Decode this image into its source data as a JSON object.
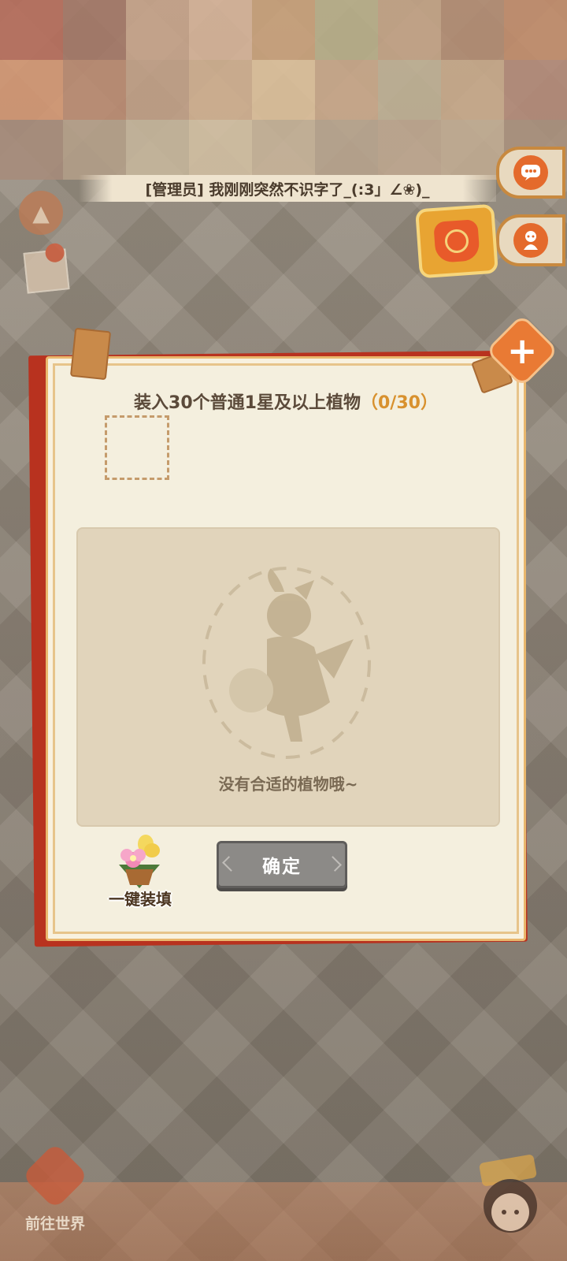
{
  "background": {
    "pixelated_colors": [
      "#b86c5a",
      "#a47766",
      "#c8a48a",
      "#d9b59a",
      "#caa179",
      "#b9b089",
      "#c4a385",
      "#b38c72",
      "#c38c6a",
      "#d69873",
      "#bb8a70",
      "#c2a086",
      "#d1b08f",
      "#e0c39c",
      "#caa889",
      "#c0b295",
      "#c9aa8a",
      "#b48a78",
      "#a88c7b",
      "#b5a089",
      "#c7b79c",
      "#d5c2a4",
      "#c8b499",
      "#b9a58e",
      "#bfa78f",
      "#c3ad93",
      "#aa917d"
    ]
  },
  "chat": {
    "message": "[管理员] 我刚刚突然不识字了_(:3」∠❀)_"
  },
  "side_buttons": {
    "chat_icon": "chat-bubble-icon",
    "ghost_icon": "spirit-icon"
  },
  "left_buttons": {
    "up_icon": "arrow-up-icon"
  },
  "dialog": {
    "title_prefix": "装入30个普通1星及以上植物",
    "title_count": "（0/30）",
    "empty_text": "没有合适的植物哦~",
    "autofill_label": "一键装填",
    "confirm_label": "确定",
    "close_icon": "plus-close-icon"
  },
  "bottom": {
    "world_label": "前往世界"
  },
  "colors": {
    "accent": "#e97a34",
    "dialog_bg": "#f4efde",
    "frame_red": "#b8321f",
    "count": "#d8912e"
  }
}
